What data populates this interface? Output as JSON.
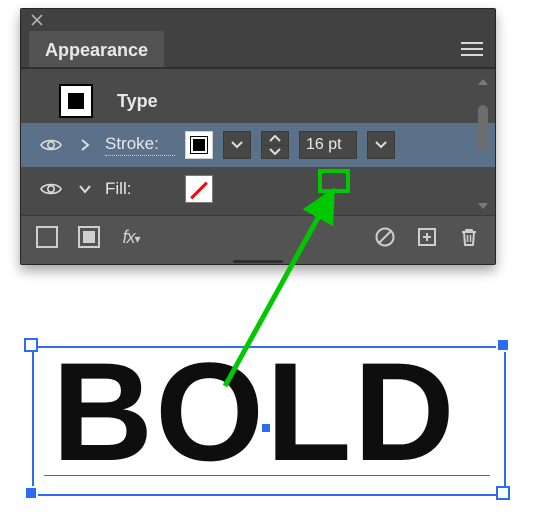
{
  "panel": {
    "title": "Appearance",
    "rows": {
      "type_label": "Type",
      "stroke_label": "Stroke:",
      "fill_label": "Fill:",
      "stroke_weight": "16 pt"
    }
  },
  "canvas": {
    "text": "BOLD"
  },
  "colors": {
    "highlight": "#00c800",
    "selection": "#2a6df4"
  }
}
